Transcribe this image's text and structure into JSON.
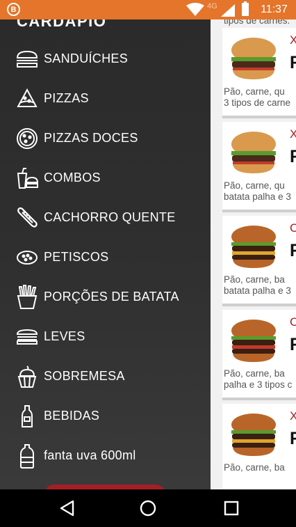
{
  "status": {
    "net": "4G",
    "time": "11:37",
    "logo": "B"
  },
  "drawer": {
    "title": "CARDÁPIO",
    "items": [
      {
        "label": "SANDUÍCHES",
        "icon": "burger-icon"
      },
      {
        "label": "PIZZAS",
        "icon": "pizza-slice-icon"
      },
      {
        "label": "PIZZAS DOCES",
        "icon": "pizza-icon"
      },
      {
        "label": "COMBOS",
        "icon": "combo-icon"
      },
      {
        "label": "CACHORRO QUENTE",
        "icon": "hotdog-icon"
      },
      {
        "label": "PETISCOS",
        "icon": "snacks-icon"
      },
      {
        "label": "PORÇÕES DE BATATA",
        "icon": "fries-icon"
      },
      {
        "label": "LEVES",
        "icon": "sandwich-icon"
      },
      {
        "label": "SOBREMESA",
        "icon": "cupcake-icon"
      },
      {
        "label": "BEBIDAS",
        "icon": "bottle-icon"
      },
      {
        "label": "fanta uva 600ml",
        "icon": "soda-bottle-icon"
      }
    ]
  },
  "content": {
    "top_desc": "tipos de carnes.",
    "cards": [
      {
        "name": "X",
        "price": "R",
        "desc1": "Pão, carne, qu",
        "desc2": "3 tipos de carne"
      },
      {
        "name": "X",
        "price": "R",
        "desc1": "Pão, carne, qu",
        "desc2": "batata palha e 3"
      },
      {
        "name": "C",
        "price": "R",
        "desc1": "Pão, carne, ba",
        "desc2": "batata palha e 3"
      },
      {
        "name": "C",
        "price": "R",
        "desc1": "Pão, carne, ba",
        "desc2": "palha e 3 tipos c"
      },
      {
        "name": "X",
        "price": "R",
        "desc1": "Pão, carne, ba",
        "desc2": ""
      }
    ]
  },
  "navbar": {
    "back": "back-icon",
    "home": "home-icon",
    "recents": "recents-icon"
  }
}
